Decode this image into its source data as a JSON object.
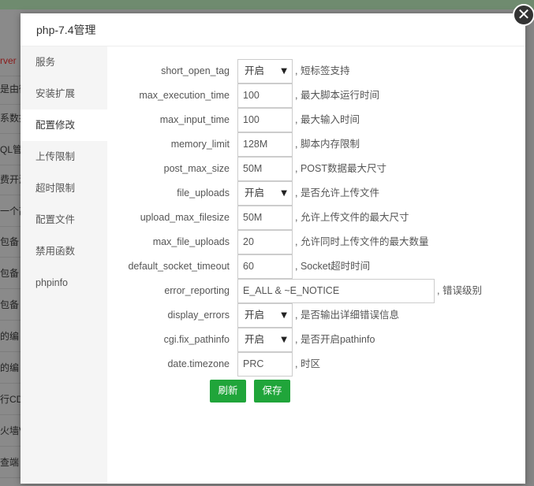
{
  "background": {
    "rows": [
      "rver",
      "是由微",
      "系数据",
      "QL管理",
      "费开源",
      "一个高",
      "包备",
      "包备",
      "包备",
      "的编",
      "的编",
      "行CD",
      "火墙V",
      "查端"
    ]
  },
  "modal": {
    "title": "php-7.4管理",
    "close_symbol": "✕"
  },
  "sidebar": {
    "items": [
      {
        "label": "服务",
        "active": false
      },
      {
        "label": "安装扩展",
        "active": false
      },
      {
        "label": "配置修改",
        "active": true
      },
      {
        "label": "上传限制",
        "active": false
      },
      {
        "label": "超时限制",
        "active": false
      },
      {
        "label": "配置文件",
        "active": false
      },
      {
        "label": "禁用函数",
        "active": false
      },
      {
        "label": "phpinfo",
        "active": false
      }
    ]
  },
  "form": {
    "rows": [
      {
        "label": "short_open_tag",
        "type": "select",
        "value": "开启",
        "desc": ", 短标签支持"
      },
      {
        "label": "max_execution_time",
        "type": "input",
        "value": "100",
        "desc": ", 最大脚本运行时间"
      },
      {
        "label": "max_input_time",
        "type": "input",
        "value": "100",
        "desc": ", 最大输入时间"
      },
      {
        "label": "memory_limit",
        "type": "input",
        "value": "128M",
        "desc": ", 脚本内存限制"
      },
      {
        "label": "post_max_size",
        "type": "input",
        "value": "50M",
        "desc": ", POST数据最大尺寸"
      },
      {
        "label": "file_uploads",
        "type": "select",
        "value": "开启",
        "desc": ", 是否允许上传文件"
      },
      {
        "label": "upload_max_filesize",
        "type": "input",
        "value": "50M",
        "desc": ", 允许上传文件的最大尺寸"
      },
      {
        "label": "max_file_uploads",
        "type": "input",
        "value": "20",
        "desc": ", 允许同时上传文件的最大数量"
      },
      {
        "label": "default_socket_timeout",
        "type": "input",
        "value": "60",
        "desc": ", Socket超时时间"
      },
      {
        "label": "error_reporting",
        "type": "input-wide",
        "value": "E_ALL & ~E_NOTICE",
        "desc": ", 错误级别"
      },
      {
        "label": "display_errors",
        "type": "select",
        "value": "开启",
        "desc": ", 是否输出详细错误信息"
      },
      {
        "label": "cgi.fix_pathinfo",
        "type": "select",
        "value": "开启",
        "desc": ", 是否开启pathinfo"
      },
      {
        "label": "date.timezone",
        "type": "input",
        "value": "PRC",
        "desc": ", 时区"
      }
    ],
    "refresh_label": "刷新",
    "save_label": "保存",
    "select_arrow": "▼"
  },
  "colors": {
    "accent": "#20a53a",
    "sidebar_bg": "#f5f5f5",
    "overlay": "#8a8a8a"
  }
}
